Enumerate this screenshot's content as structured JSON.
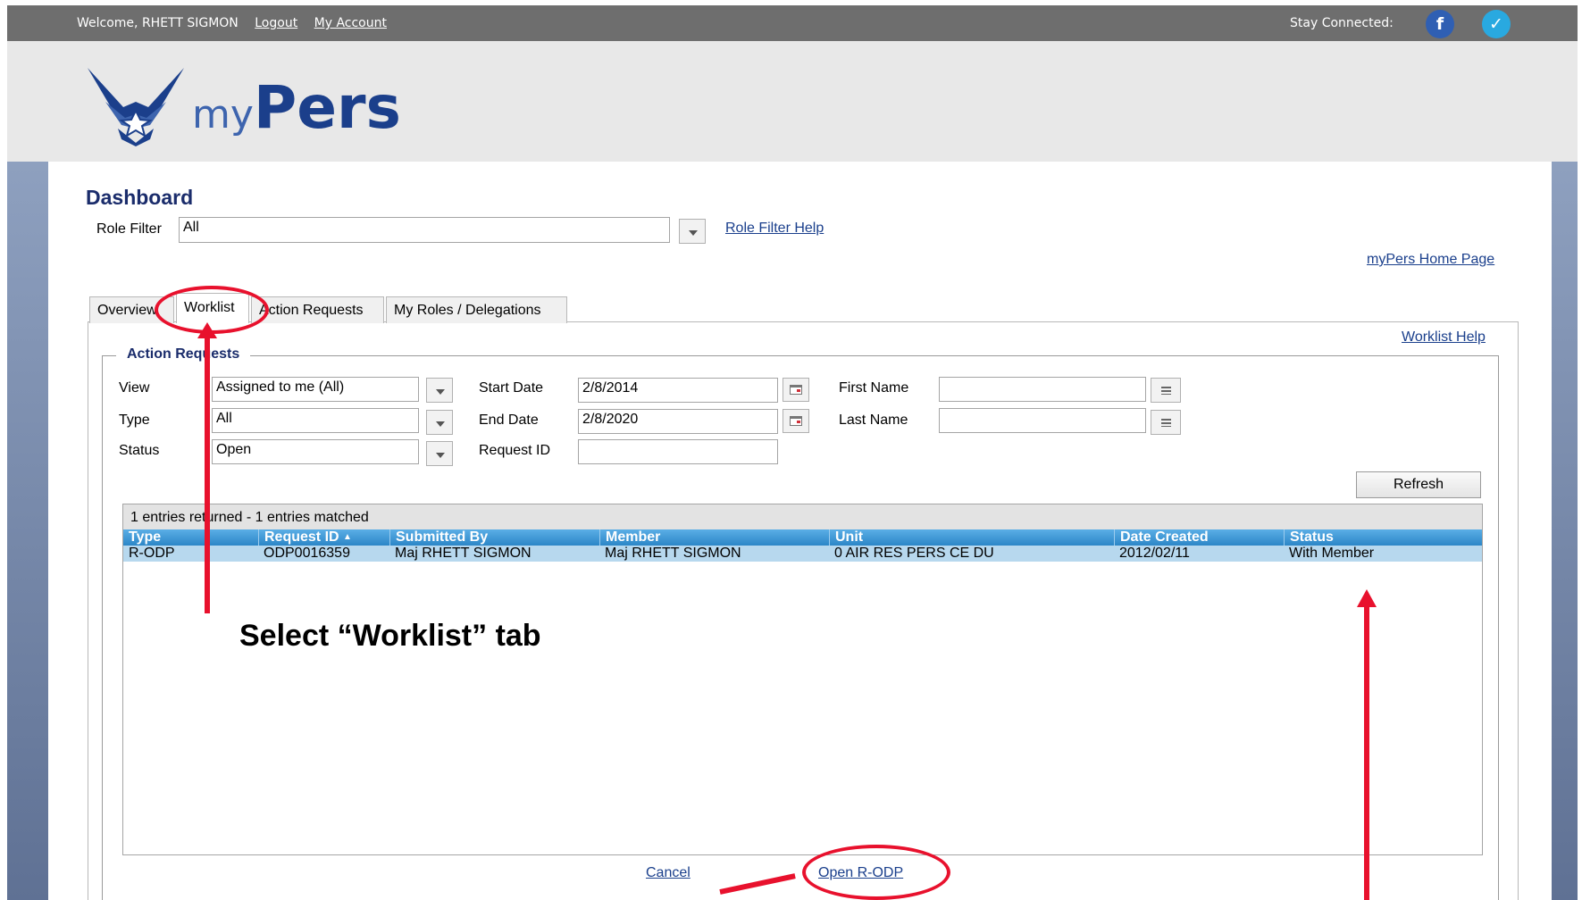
{
  "topbar": {
    "welcome": "Welcome, RHETT SIGMON",
    "logout": "Logout",
    "my_account": "My Account",
    "stay_connected": "Stay Connected:",
    "facebook_glyph": "f",
    "twitter_glyph": "✓"
  },
  "logo": {
    "my": "my",
    "pers": "Pers"
  },
  "page": {
    "title": "Dashboard",
    "home_link": "myPers Home Page"
  },
  "role_filter": {
    "label": "Role Filter",
    "value": "All",
    "help": "Role Filter Help"
  },
  "tabs": [
    {
      "label": "Overview",
      "active": false
    },
    {
      "label": "Worklist",
      "active": true
    },
    {
      "label": "Action Requests",
      "active": false
    },
    {
      "label": "My Roles / Delegations",
      "active": false
    }
  ],
  "worklist_help": "Worklist Help",
  "section_title": "Action Requests",
  "filters": {
    "view": {
      "label": "View",
      "value": "Assigned to me (All)"
    },
    "type": {
      "label": "Type",
      "value": "All"
    },
    "status": {
      "label": "Status",
      "value": "Open"
    },
    "start_date": {
      "label": "Start Date",
      "value": "2/8/2014"
    },
    "end_date": {
      "label": "End Date",
      "value": "2/8/2020"
    },
    "request_id": {
      "label": "Request ID",
      "value": ""
    },
    "first_name": {
      "label": "First Name",
      "value": ""
    },
    "last_name": {
      "label": "Last Name",
      "value": ""
    }
  },
  "refresh_label": "Refresh",
  "grid": {
    "info": "1 entries returned - 1 entries matched",
    "columns": [
      "Type",
      "Request ID",
      "Submitted By",
      "Member",
      "Unit",
      "Date Created",
      "Status"
    ],
    "sort_indicator": "▲",
    "rows": [
      [
        "R-ODP",
        "ODP0016359",
        "Maj RHETT SIGMON",
        "Maj RHETT SIGMON",
        "0 AIR RES PERS CE DU",
        "2012/02/11",
        "With Member"
      ]
    ]
  },
  "actions": {
    "cancel": "Cancel",
    "open": "Open R-ODP"
  },
  "annotation": "Select “Worklist” tab",
  "colors": {
    "annotation_red": "#e8112d",
    "grid_header": "#3a95d4",
    "selected_row": "#b7d8ee",
    "topbar": "#6e6e6e",
    "title_navy": "#1a2c6b"
  }
}
